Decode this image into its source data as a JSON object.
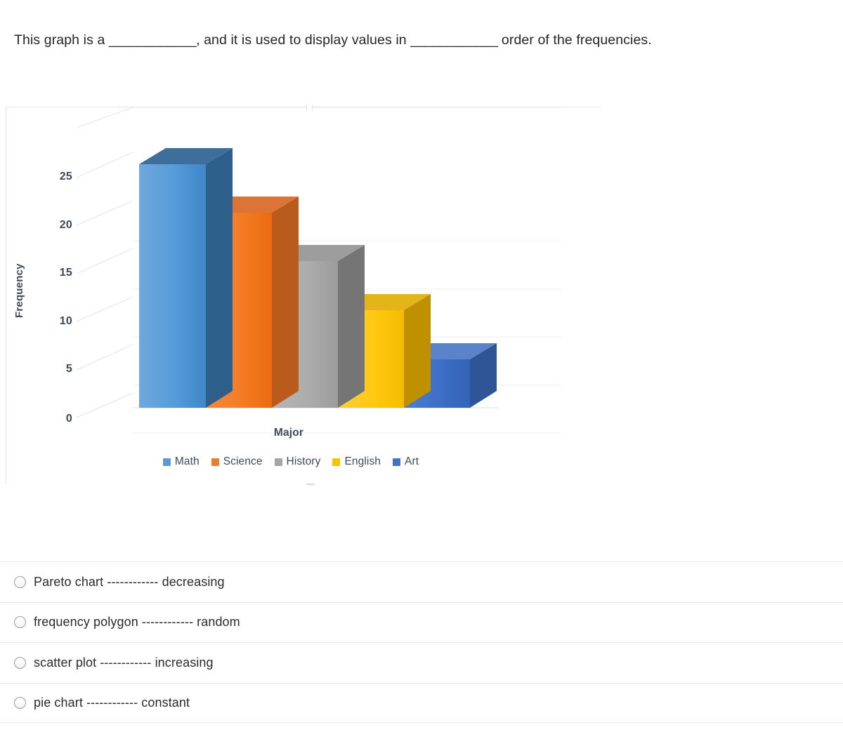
{
  "question": {
    "part1": "This graph is a",
    "blank1": "____________",
    "part2": ", and it is used to display values in",
    "blank2": "____________",
    "part3": "order of the frequencies."
  },
  "chart_data": {
    "type": "bar",
    "style": "3d-column-pareto",
    "title": "",
    "xlabel": "Major",
    "ylabel": "Frequency",
    "categories": [
      "Math",
      "Science",
      "History",
      "English",
      "Art"
    ],
    "values": [
      26,
      21,
      16,
      11,
      6
    ],
    "ylim": [
      0,
      25
    ],
    "yticks": [
      25,
      20,
      15,
      10,
      5,
      0
    ],
    "ytick_labels": [
      "25",
      "20",
      "15",
      "10",
      "5",
      "0"
    ],
    "grid": true,
    "legend_position": "bottom",
    "series": [
      {
        "name": "Math",
        "value": 26,
        "color": "#5B9BD5"
      },
      {
        "name": "Science",
        "value": 21,
        "color": "#ED7D31"
      },
      {
        "name": "History",
        "value": 16,
        "color": "#A5A5A5"
      },
      {
        "name": "English",
        "value": 11,
        "color": "#FFC000"
      },
      {
        "name": "Art",
        "value": 6,
        "color": "#4472C4"
      }
    ],
    "legend": [
      {
        "label": "Math",
        "color": "#5B9BD5"
      },
      {
        "label": "Science",
        "color": "#ED7D31"
      },
      {
        "label": "History",
        "color": "#A5A5A5"
      },
      {
        "label": "English",
        "color": "#FFC000"
      },
      {
        "label": "Art",
        "color": "#4472C4"
      }
    ]
  },
  "options": [
    {
      "label": "Pareto chart ------------ decreasing"
    },
    {
      "label": "frequency polygon ------------ random"
    },
    {
      "label": "scatter plot ------------ increasing"
    },
    {
      "label": "pie chart ------------ constant"
    }
  ]
}
